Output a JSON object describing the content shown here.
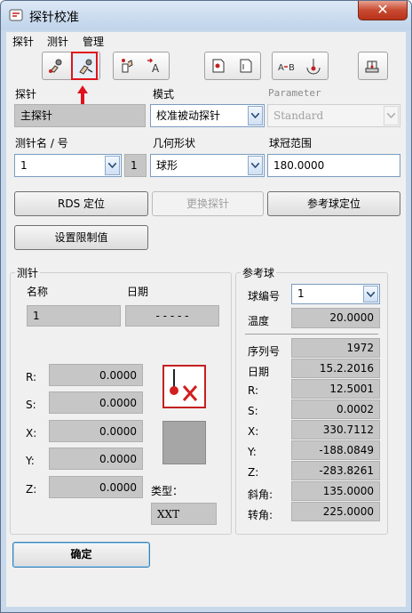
{
  "window": {
    "title": "探针校准",
    "close_label": "✕"
  },
  "menu": [
    "探针",
    "测针",
    "管理"
  ],
  "toolbar": {
    "buttons": [
      "probe-icon",
      "probe-calibrate-icon",
      "touch-icon",
      "move-a-icon",
      "page-pin-icon",
      "page-icon",
      "ab-compare-icon",
      "target-icon",
      "machine-icon"
    ],
    "selected": "probe-calibrate-icon",
    "highlight_color": "#e0131c"
  },
  "probe": {
    "label": "探针",
    "value": "主探针",
    "mode_label": "模式",
    "mode_value": "校准被动探针",
    "param_label": "Parameter",
    "param_value": "Standard"
  },
  "stylus": {
    "name_label": "测针名 / 号",
    "name_value": "1",
    "number_value": "1",
    "geom_label": "几何形状",
    "geom_value": "球形",
    "range_label": "球冠范围",
    "range_value": "180.0000"
  },
  "buttons": {
    "rds": "RDS 定位",
    "change": "更换探针",
    "ref_ball": "参考球定位",
    "limits": "设置限制值",
    "ok": "确定"
  },
  "stylus_group": {
    "title": "测针",
    "name_col": "名称",
    "date_col": "日期",
    "name_value": "1",
    "date_value": "- - - - -",
    "rows": [
      {
        "label": "R:",
        "value": "0.0000"
      },
      {
        "label": "S:",
        "value": "0.0000"
      },
      {
        "label": "X:",
        "value": "0.0000"
      },
      {
        "label": "Y:",
        "value": "0.0000"
      },
      {
        "label": "Z:",
        "value": "0.0000"
      }
    ],
    "type_label": "类型：",
    "type_value": "XXT",
    "status_icon": "stylus-not-calibrated-icon"
  },
  "ref_group": {
    "title": "参考球",
    "ball_no_label": "球编号",
    "ball_no_value": "1",
    "temp_label": "温度",
    "temp_value": "20.0000",
    "rows": [
      {
        "label": "序列号",
        "value": "1972"
      },
      {
        "label": "日期",
        "value": "15.2.2016"
      },
      {
        "label": "R:",
        "value": "12.5001"
      },
      {
        "label": "S:",
        "value": "0.0002"
      },
      {
        "label": "X:",
        "value": "330.7112"
      },
      {
        "label": "Y:",
        "value": "-188.0849"
      },
      {
        "label": "Z:",
        "value": "-283.8261"
      },
      {
        "label": "斜角:",
        "value": "135.0000"
      },
      {
        "label": "转角:",
        "value": "225.0000"
      }
    ]
  }
}
